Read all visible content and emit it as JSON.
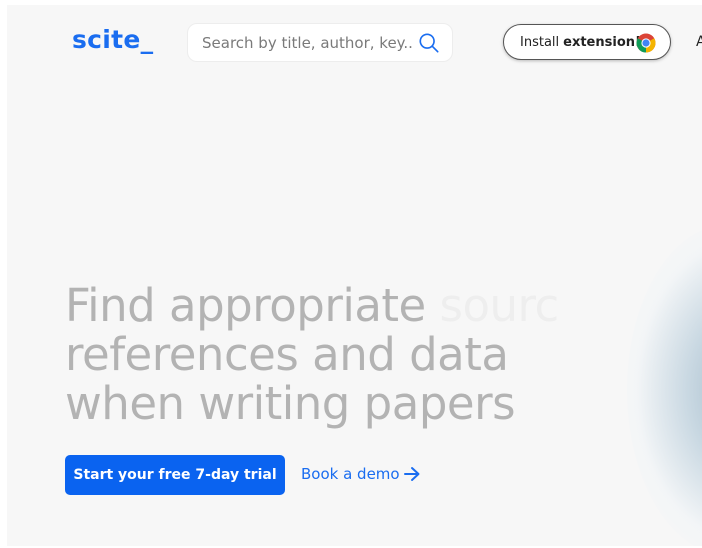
{
  "header": {
    "logo": "scite_",
    "search": {
      "placeholder": "Search by title, author, key..."
    },
    "install_button": {
      "prefix": "Install",
      "bold": "extension!",
      "icon": "chrome-icon"
    },
    "nav_cut_text": "A"
  },
  "hero": {
    "title_line_1": "Find appropriate",
    "title_ghost": "sourc",
    "title_line_2": "references and data",
    "title_line_3": "when writing papers",
    "primary_cta": "Start your free 7-day trial",
    "secondary_cta": "Book a demo"
  },
  "colors": {
    "brand_blue": "#0a63f0",
    "link_blue": "#1a6df0",
    "hero_text": "#b3b3b3",
    "page_bg": "#f7f7f7"
  }
}
